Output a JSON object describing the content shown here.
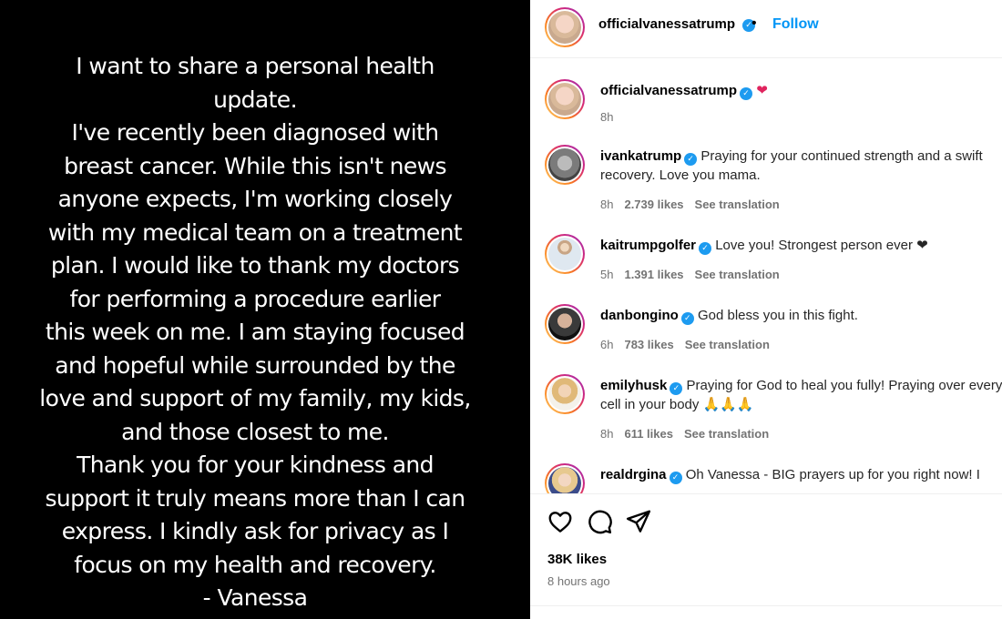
{
  "story": {
    "lines": [
      "I want to share a personal health",
      "update.",
      "I've recently been diagnosed with",
      "breast cancer. While this isn't news",
      "anyone expects, I'm working closely",
      "with my medical team on a treatment",
      "plan. I would like to thank my doctors",
      "for performing a procedure earlier",
      "this week on me. I am staying focused",
      "and hopeful while surrounded by the",
      "love and support of my family, my kids,",
      "and those closest to me.",
      "Thank you for your kindness and",
      "support it truly means more than I can",
      "express. I kindly ask for privacy as I",
      "focus on my health and recovery.",
      "- Vanessa"
    ]
  },
  "header": {
    "username": "officialvanessatrump",
    "separator": "•",
    "follow_label": "Follow"
  },
  "caption": {
    "username": "officialvanessatrump",
    "emoji": "❤",
    "time": "8h"
  },
  "comments": [
    {
      "username": "ivankatrump",
      "text": "Praying for your continued strength and a swift recovery. Love you mama.",
      "time": "8h",
      "likes": "2.739 likes",
      "translate": "See translation"
    },
    {
      "username": "kaitrumpgolfer",
      "text": "Love you! Strongest person ever ❤",
      "time": "5h",
      "likes": "1.391 likes",
      "translate": "See translation"
    },
    {
      "username": "danbongino",
      "text": "God bless you in this fight.",
      "time": "6h",
      "likes": "783 likes",
      "translate": "See translation"
    },
    {
      "username": "emilyhusk",
      "text": "Praying for God to heal you fully! Praying over every cell in your body 🙏🙏🙏",
      "time": "8h",
      "likes": "611 likes",
      "translate": "See translation"
    },
    {
      "username": "realdrgina",
      "text": "Oh Vanessa - BIG prayers up for you right now! I",
      "time": "",
      "likes": "",
      "translate": ""
    }
  ],
  "post": {
    "likes": "38K likes",
    "time_ago": "8 hours ago"
  },
  "icons": {
    "verified": "verified-badge-icon",
    "like": "heart-outline-icon",
    "comment": "comment-bubble-icon",
    "share": "paper-plane-icon"
  },
  "colors": {
    "follow": "#0095f6",
    "verified": "#1d9bf0",
    "heart": "#e0245e",
    "meta": "#737373"
  }
}
